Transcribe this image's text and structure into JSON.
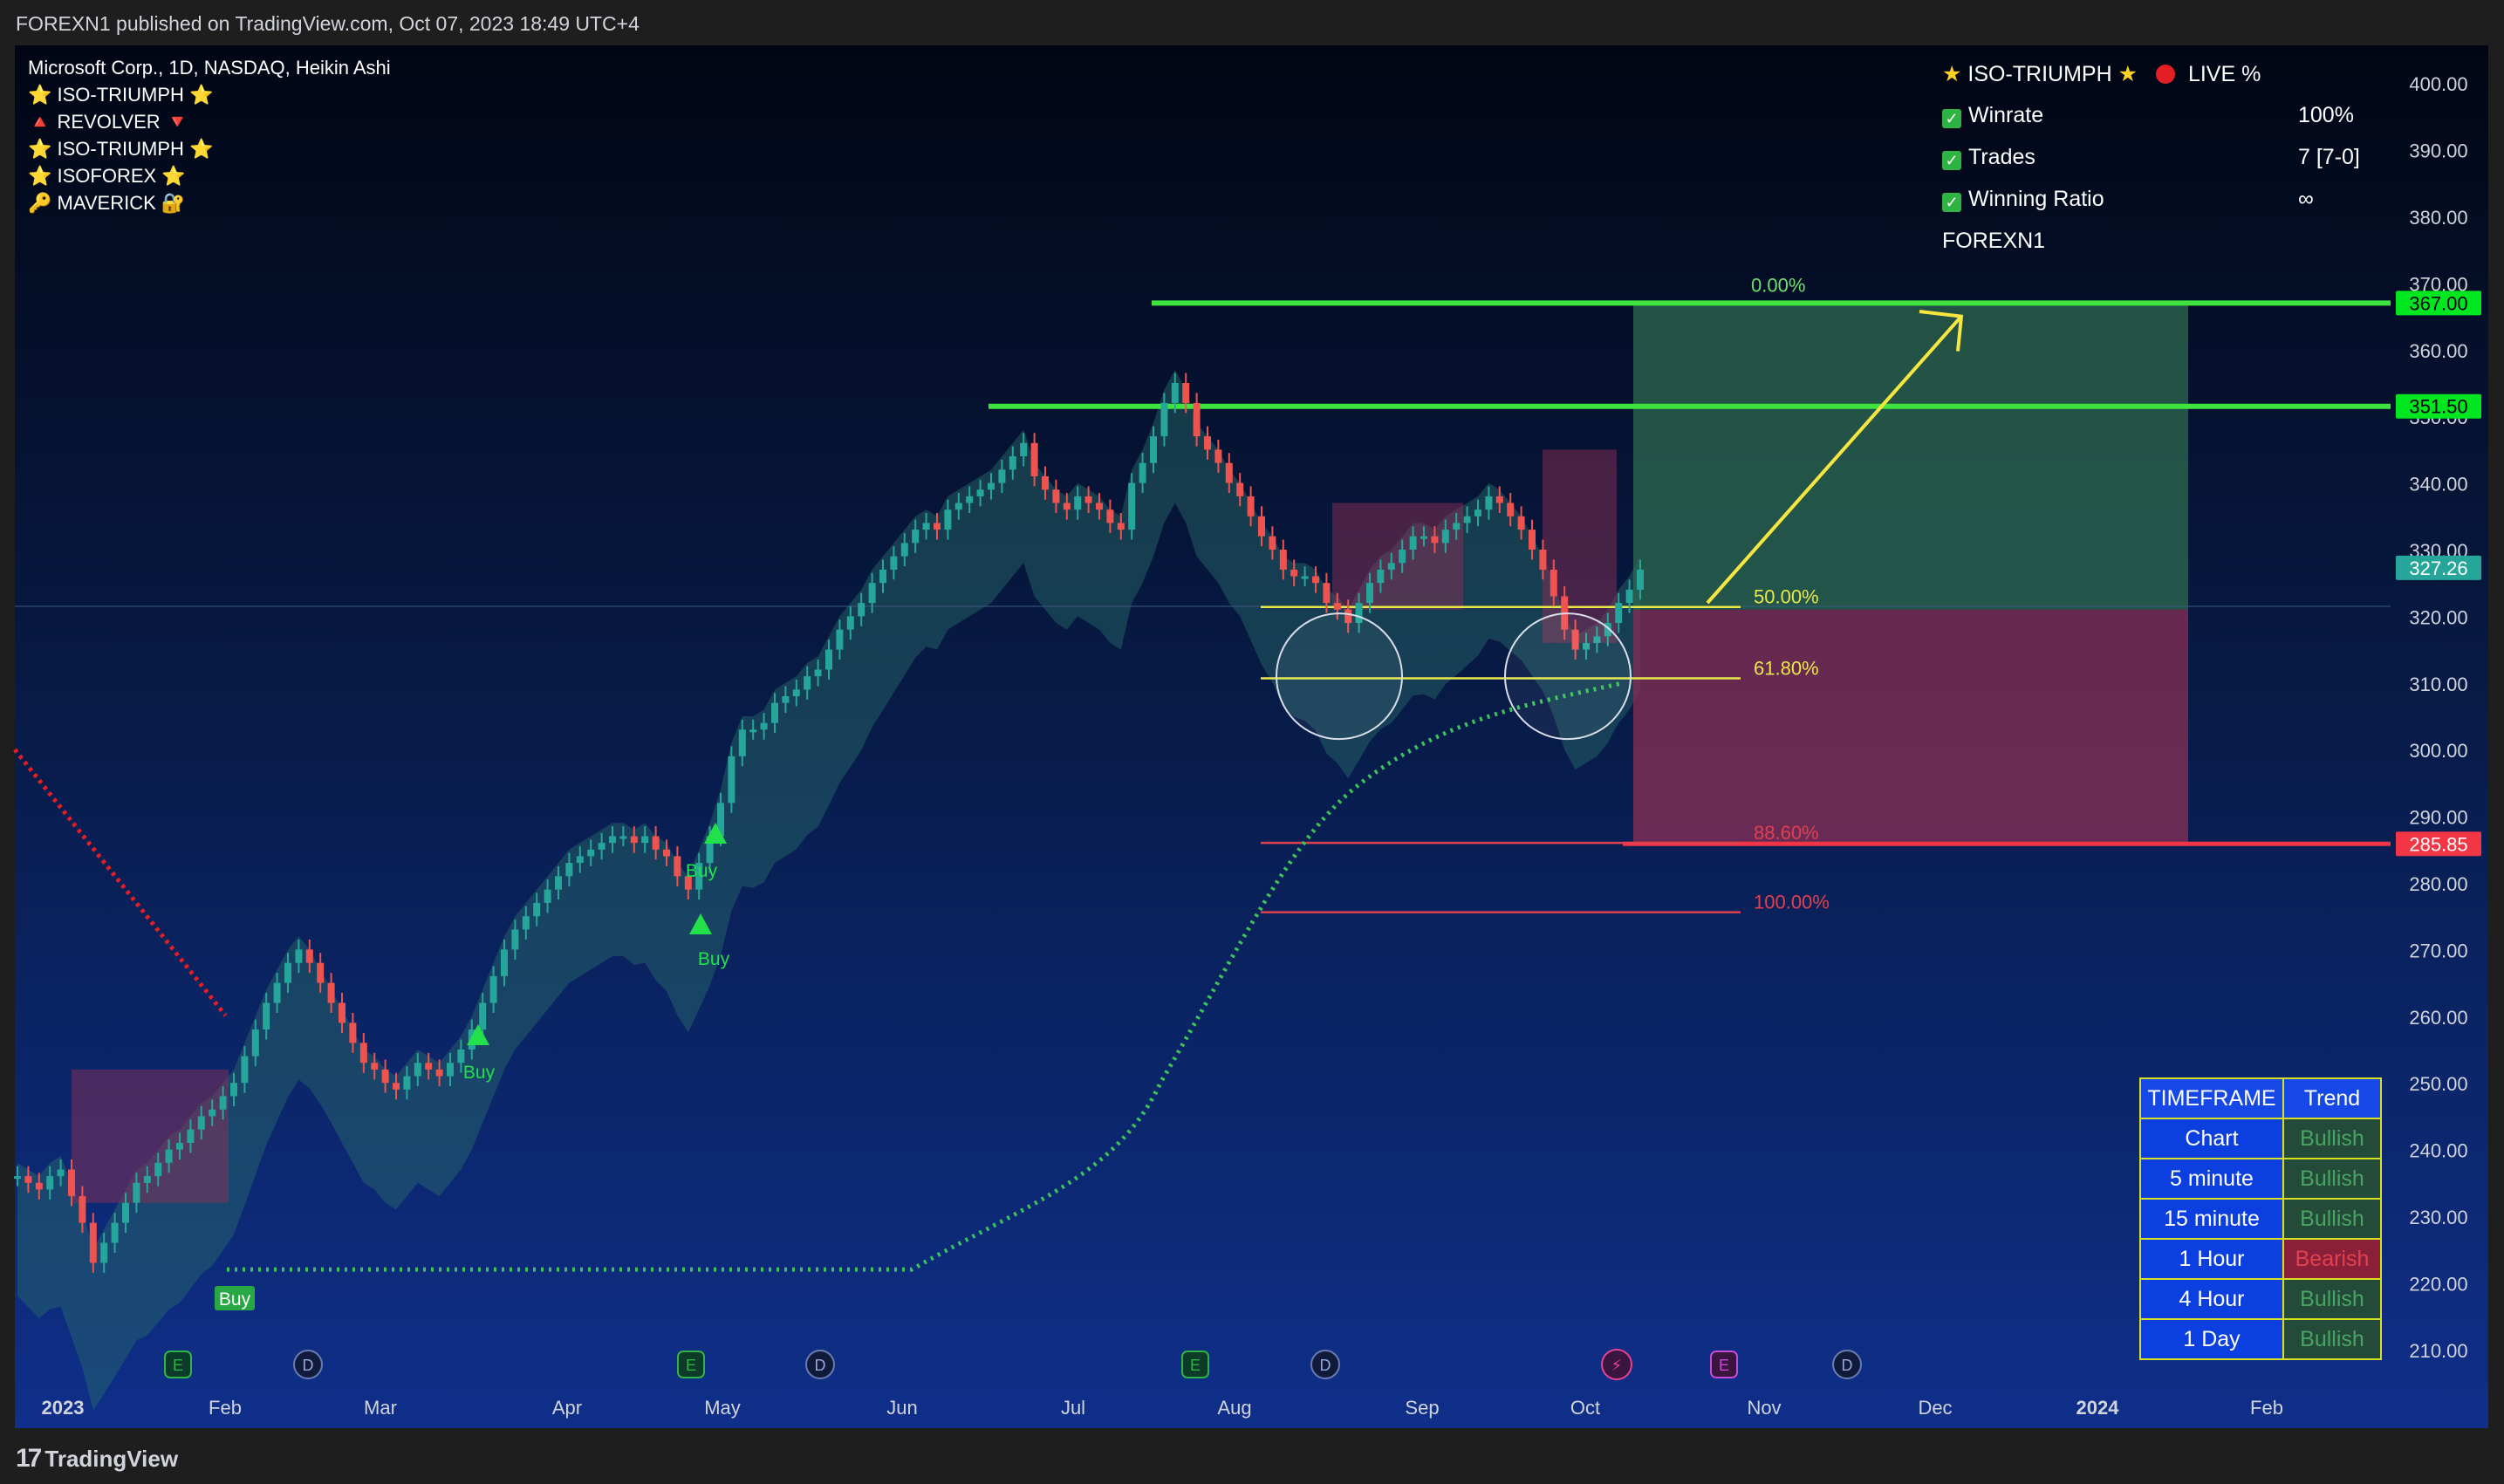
{
  "header": {
    "published": "FOREXN1 published on TradingView.com, Oct 07, 2023 18:49 UTC+4"
  },
  "footer": {
    "brand": "TradingView"
  },
  "legend": {
    "symbol": "Microsoft Corp., 1D, NASDAQ, Heikin Ashi",
    "indicators": [
      "⭐ ISO-TRIUMPH ⭐",
      "🔺 REVOLVER 🔻",
      "⭐ ISO-TRIUMPH ⭐",
      "⭐ ISOFOREX ⭐",
      "🔑 MAVERICK 🔐"
    ]
  },
  "stats": {
    "title": "ISO-TRIUMPH",
    "live": "LIVE %",
    "rows": [
      {
        "label": "Winrate",
        "value": "100%"
      },
      {
        "label": "Trades",
        "value": "7 [7-0]"
      },
      {
        "label": "Winning Ratio",
        "value": "∞"
      }
    ],
    "author": "FOREXN1"
  },
  "timeframe_table": {
    "headers": [
      "TIMEFRAME",
      "Trend"
    ],
    "rows": [
      {
        "tf": "Chart",
        "trend": "Bullish"
      },
      {
        "tf": "5 minute",
        "trend": "Bullish"
      },
      {
        "tf": "15 minute",
        "trend": "Bullish"
      },
      {
        "tf": "1 Hour",
        "trend": "Bearish"
      },
      {
        "tf": "4 Hour",
        "trend": "Bullish"
      },
      {
        "tf": "1 Day",
        "trend": "Bullish"
      }
    ]
  },
  "chart_data": {
    "type": "candlestick",
    "ylim": [
      210,
      400
    ],
    "y_ticks": [
      210,
      220,
      230,
      240,
      250,
      260,
      270,
      280,
      290,
      300,
      310,
      320,
      330,
      340,
      350,
      360,
      370,
      380,
      390,
      400
    ],
    "x_ticks": [
      "2023",
      "Feb",
      "Mar",
      "Apr",
      "May",
      "Jun",
      "Jul",
      "Aug",
      "Sep",
      "Oct",
      "Nov",
      "Dec",
      "2024",
      "Feb"
    ],
    "price_labels": [
      {
        "value": 367.0,
        "text": "367.00",
        "color": "#00e61f"
      },
      {
        "value": 351.5,
        "text": "351.50",
        "color": "#00e61f"
      },
      {
        "value": 327.26,
        "text": "327.26",
        "color": "#26a69a"
      },
      {
        "value": 285.85,
        "text": "285.85",
        "color": "#f23645"
      }
    ],
    "horizontal_levels": [
      367.0,
      351.5,
      285.85
    ],
    "fibonacci": [
      {
        "label": "0.00%",
        "value": 367.0,
        "color": "#6fe06f"
      },
      {
        "label": "50.00%",
        "value": 321.4,
        "color": "#e8e84a"
      },
      {
        "label": "61.80%",
        "value": 310.7,
        "color": "#e8e84a"
      },
      {
        "label": "88.60%",
        "value": 286.0,
        "color": "#e0414f"
      },
      {
        "label": "100.00%",
        "value": 275.6,
        "color": "#e0414f"
      }
    ],
    "position": {
      "target": 367.0,
      "entry": 321.0,
      "stop": 285.85
    },
    "signals": [
      {
        "text": "Buy",
        "price": 222
      },
      {
        "text": "Buy",
        "price": 258
      },
      {
        "text": "Buy",
        "price": 284
      },
      {
        "text": "Buy",
        "price": 277
      }
    ],
    "events": [
      "E",
      "D",
      "E",
      "D",
      "E",
      "D",
      "⚡",
      "E",
      "D"
    ],
    "closes": [
      236,
      235,
      234,
      236,
      237,
      233,
      229,
      223,
      226,
      229,
      232,
      235,
      236,
      238,
      240,
      241,
      243,
      245,
      246,
      248,
      250,
      254,
      258,
      262,
      265,
      268,
      270,
      268,
      265,
      262,
      259,
      256,
      253,
      252,
      250,
      249,
      251,
      253,
      252,
      251,
      253,
      255,
      258,
      262,
      266,
      270,
      273,
      275,
      277,
      279,
      281,
      283,
      284,
      285,
      286,
      287,
      287,
      286,
      287,
      285,
      284,
      281,
      279,
      283,
      287,
      292,
      299,
      303,
      303,
      304,
      307,
      308,
      309,
      311,
      312,
      315,
      318,
      320,
      322,
      325,
      327,
      329,
      331,
      333,
      334,
      333,
      336,
      337,
      338,
      339,
      340,
      342,
      344,
      346,
      341,
      339,
      337,
      336,
      338,
      337,
      336,
      334,
      333,
      340,
      343,
      347,
      352,
      355,
      352,
      347,
      345,
      343,
      340,
      338,
      335,
      332,
      330,
      327,
      326,
      326,
      325,
      322,
      321,
      319,
      322,
      325,
      327,
      328,
      330,
      332,
      332,
      331,
      333,
      334,
      335,
      336,
      338,
      337,
      335,
      333,
      330,
      327,
      323,
      318,
      315,
      316,
      317,
      319,
      322,
      324,
      327
    ]
  }
}
